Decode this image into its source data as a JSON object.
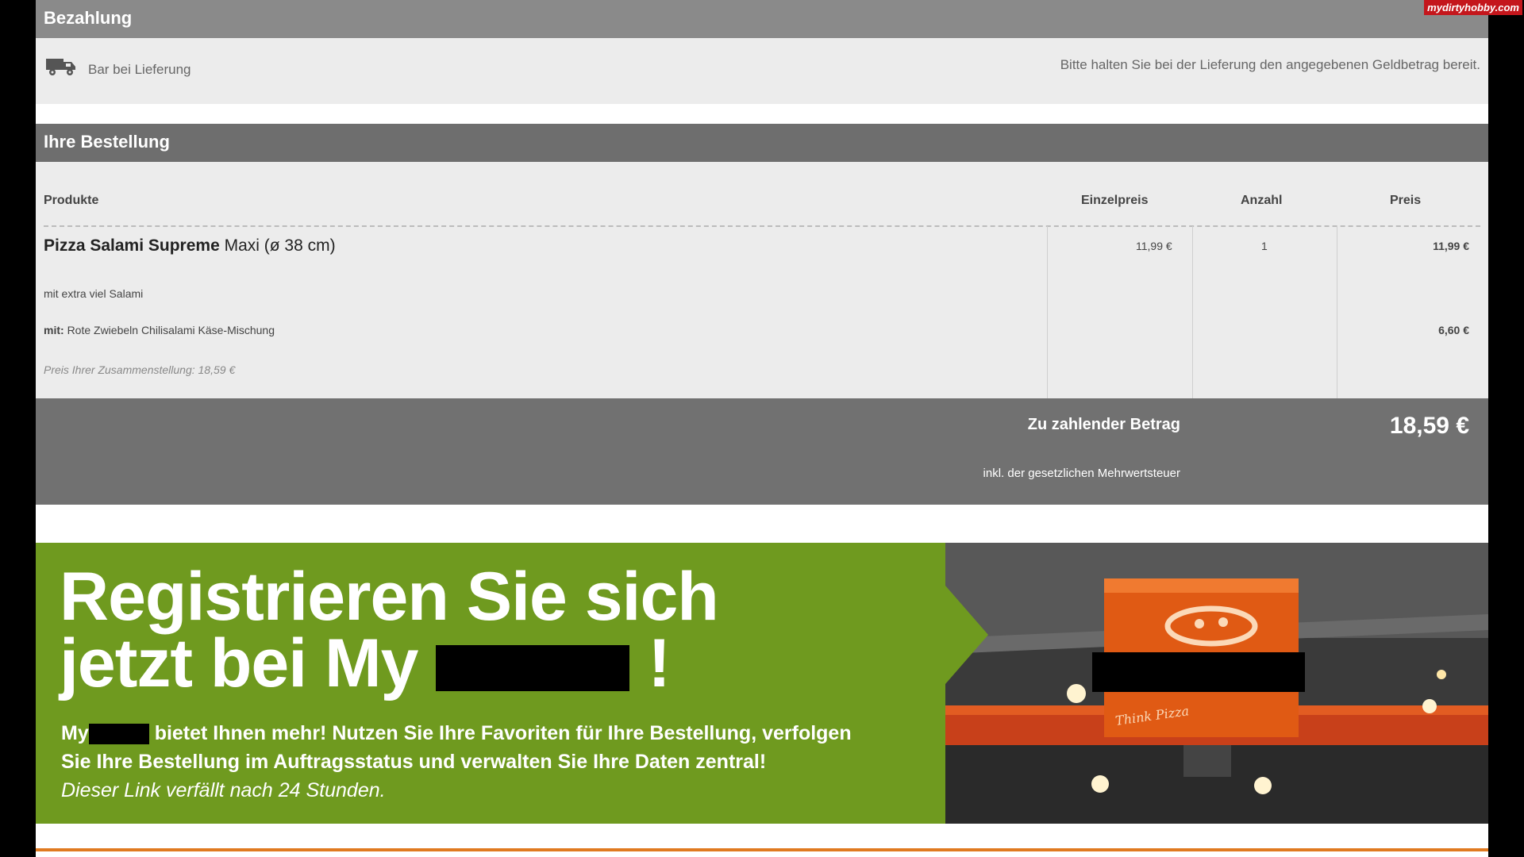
{
  "payment": {
    "header": "Bezahlung",
    "method": "Bar bei Lieferung",
    "note": "Bitte halten Sie bei der Lieferung den angegebenen Geldbetrag bereit."
  },
  "order": {
    "header": "Ihre Bestellung",
    "columns": {
      "products": "Produkte",
      "unit_price": "Einzelpreis",
      "quantity": "Anzahl",
      "price": "Preis"
    },
    "item": {
      "name": "Pizza Salami Supreme",
      "size": "Maxi (ø 38 cm)",
      "unit_price": "11,99 €",
      "quantity": "1",
      "price": "11,99 €",
      "note": "mit extra viel Salami",
      "extras_label": "mit:",
      "extras": "Rote Zwiebeln Chilisalami Käse-Mischung",
      "extras_price": "6,60 €",
      "composition": "Preis Ihrer Zusammenstellung: 18,59 €"
    },
    "total_label": "Zu zahlender Betrag",
    "total_value": "18,59 €",
    "vat_note": "inkl. der gesetzlichen Mehrwertsteuer"
  },
  "promo": {
    "title_line1": "Registrieren Sie sich",
    "title_line2_prefix": "jetzt bei My",
    "title_line2_suffix": "!",
    "body_prefix": "My",
    "body_line1": "bietet Ihnen mehr! Nutzen Sie Ihre Favoriten für Ihre Bestellung, verfolgen",
    "body_line2": "Sie Ihre Bestellung im Auftragsstatus und verwalten Sie Ihre Daten zentral!",
    "body_line3": "Dieser Link verfällt nach 24 Stunden.",
    "sign_text": "Think Pizza"
  },
  "watermark": "mydirtyhobby.com",
  "colors": {
    "header_gray": "#7b7b7b",
    "panel_gray": "#ececec",
    "promo_green": "#6f9a1f",
    "sign_orange": "#e05a14"
  }
}
